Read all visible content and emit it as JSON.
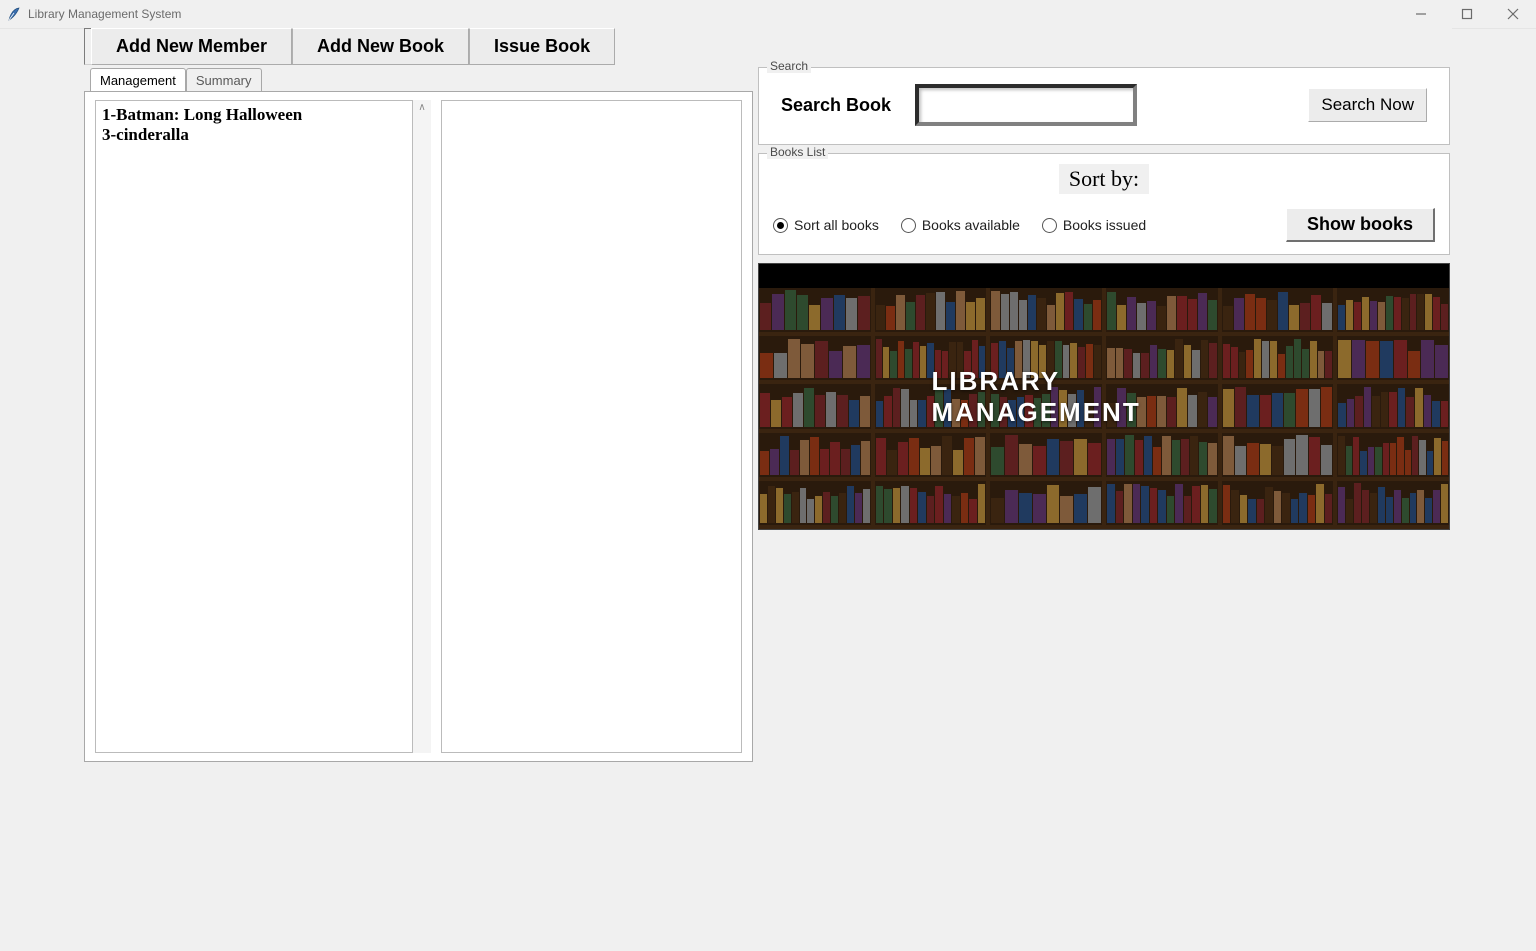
{
  "window": {
    "title": "Library Management System"
  },
  "toolbar": {
    "add_member": "Add New Member",
    "add_book": "Add New Book",
    "issue_book": "Issue Book"
  },
  "tabs": {
    "management": "Management",
    "summary": "Summary"
  },
  "left_list_items": [
    "1-Batman: Long Halloween",
    "3-cinderalla"
  ],
  "search": {
    "group_title": "Search",
    "label": "Search Book",
    "value": "",
    "button": "Search Now"
  },
  "books_list": {
    "group_title": "Books List",
    "sort_by_label": "Sort by:",
    "radio_all": "Sort all books",
    "radio_available": "Books available",
    "radio_issued": "Books issued",
    "selected": "all",
    "show_button": "Show books"
  },
  "image_caption": "LIBRARY MANAGEMENT",
  "book_colors": [
    "#6b1f1f",
    "#7a2d12",
    "#8c6a2c",
    "#2e4a2e",
    "#203a5f",
    "#4b2a55",
    "#7e5a3a",
    "#5c1f1f",
    "#3a2410",
    "#6e6e6e"
  ]
}
